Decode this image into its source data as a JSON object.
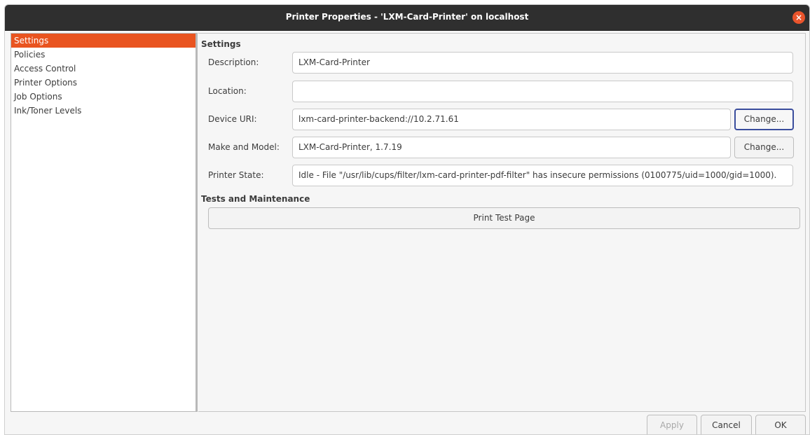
{
  "window": {
    "title": "Printer Properties - 'LXM-Card-Printer' on localhost",
    "close_icon": "×"
  },
  "sidebar": {
    "items": [
      {
        "label": "Settings",
        "selected": true
      },
      {
        "label": "Policies"
      },
      {
        "label": "Access Control"
      },
      {
        "label": "Printer Options"
      },
      {
        "label": "Job Options"
      },
      {
        "label": "Ink/Toner Levels"
      }
    ]
  },
  "settings": {
    "header": "Settings",
    "description_label": "Description:",
    "description_value": "LXM-Card-Printer",
    "location_label": "Location:",
    "location_value": "",
    "device_uri_label": "Device URI:",
    "device_uri_value": "lxm-card-printer-backend://10.2.71.61",
    "device_uri_change": "Change...",
    "make_model_label": "Make and Model:",
    "make_model_value": "LXM-Card-Printer, 1.7.19",
    "make_model_change": "Change...",
    "printer_state_label": "Printer State:",
    "printer_state_value": "Idle - File \"/usr/lib/cups/filter/lxm-card-printer-pdf-filter\" has insecure permissions (0100775/uid=1000/gid=1000)."
  },
  "tests": {
    "header": "Tests and Maintenance",
    "print_test_page": "Print Test Page"
  },
  "footer": {
    "apply": "Apply",
    "cancel": "Cancel",
    "ok": "OK"
  },
  "colors": {
    "accent": "#e95420",
    "titlebar": "#2f2f2f",
    "focus_border": "#3a4d9d"
  }
}
